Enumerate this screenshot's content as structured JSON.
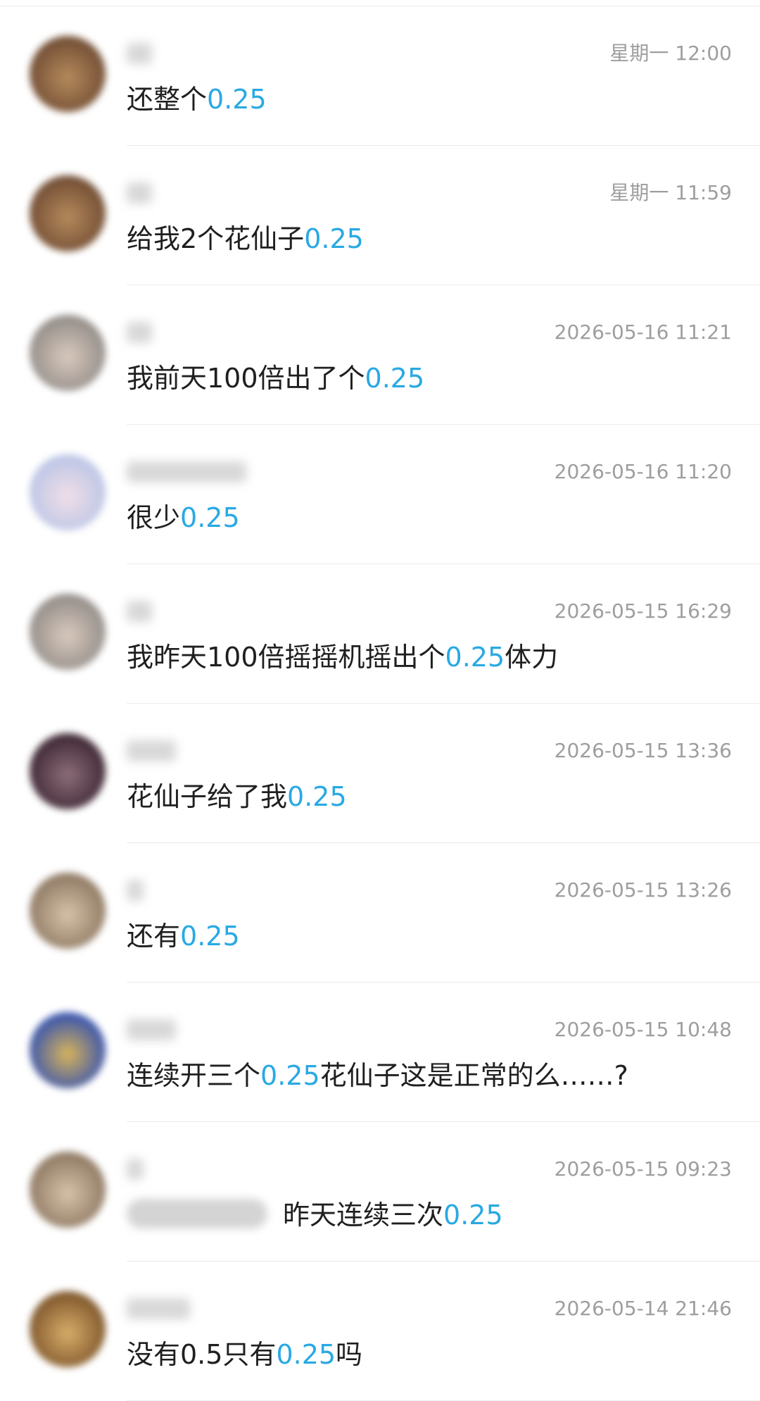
{
  "messages": [
    {
      "time": "星期一 12:00",
      "before": "还整个",
      "keyword": "0.25",
      "after": "",
      "avatar_colors": [
        "#6e4a32",
        "#b58a5c"
      ],
      "name_width": 36,
      "mention": false
    },
    {
      "time": "星期一 11:59",
      "before": "给我2个花仙子",
      "keyword": "0.25",
      "after": "",
      "avatar_colors": [
        "#6e4a32",
        "#b58a5c"
      ],
      "name_width": 36,
      "mention": false
    },
    {
      "time": "2026-05-16 11:21",
      "before": "我前天100倍出了个",
      "keyword": "0.25",
      "after": "",
      "avatar_colors": [
        "#8f8a86",
        "#d9c9bd"
      ],
      "name_width": 36,
      "mention": false
    },
    {
      "time": "2026-05-16 11:20",
      "before": "很少",
      "keyword": "0.25",
      "after": "",
      "avatar_colors": [
        "#b9c4e6",
        "#f0dfe8"
      ],
      "name_width": 170,
      "mention": false
    },
    {
      "time": "2026-05-15 16:29",
      "before": "我昨天100倍摇摇机摇出个",
      "keyword": "0.25",
      "after": "体力",
      "avatar_colors": [
        "#8f8a86",
        "#d9c9bd"
      ],
      "name_width": 36,
      "mention": false
    },
    {
      "time": "2026-05-15 13:36",
      "before": "花仙子给了我",
      "keyword": "0.25",
      "after": "",
      "avatar_colors": [
        "#3a2430",
        "#8c6e7a"
      ],
      "name_width": 70,
      "mention": false
    },
    {
      "time": "2026-05-15 13:26",
      "before": "还有",
      "keyword": "0.25",
      "after": "",
      "avatar_colors": [
        "#8b7560",
        "#d6c3a8"
      ],
      "name_width": 24,
      "mention": false
    },
    {
      "time": "2026-05-15 10:48",
      "before": "连续开三个",
      "keyword": "0.25",
      "after": "花仙子这是正常的么……?",
      "avatar_colors": [
        "#2f4fb3",
        "#d9b45a"
      ],
      "name_width": 70,
      "mention": false
    },
    {
      "time": "2026-05-15 09:23",
      "before": "昨天连续三次",
      "keyword": "0.25",
      "after": "",
      "avatar_colors": [
        "#8b7560",
        "#d6c3a8"
      ],
      "name_width": 24,
      "mention": true
    },
    {
      "time": "2026-05-14 21:46",
      "before": "没有0.5只有",
      "keyword": "0.25",
      "after": "吗",
      "avatar_colors": [
        "#7a5228",
        "#d8ad6a"
      ],
      "name_width": 90,
      "mention": false
    }
  ]
}
